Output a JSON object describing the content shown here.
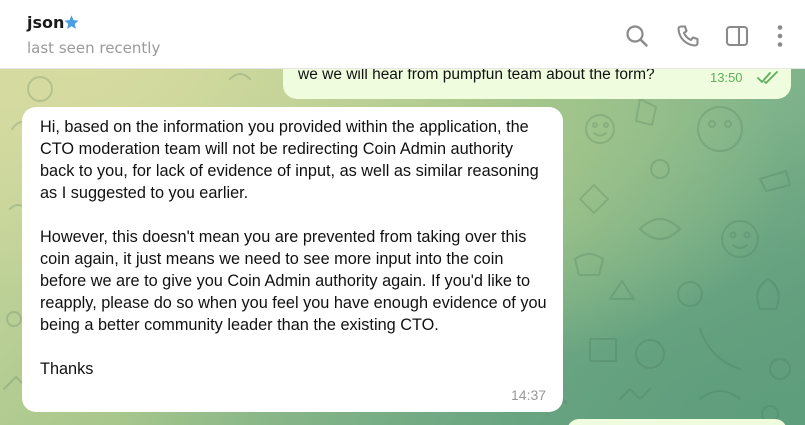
{
  "header": {
    "contact_name": "json",
    "status": "last seen recently",
    "icons": [
      "search-icon",
      "phone-icon",
      "sidebar-toggle-icon",
      "more-options-icon"
    ],
    "verified_star_color": "#4a9fe3"
  },
  "messages": [
    {
      "direction": "outgoing",
      "text": "we we will hear from pumpfun team about the form?",
      "time": "13:50",
      "read": true
    },
    {
      "direction": "incoming",
      "paragraphs": [
        "Hi, based on the information you provided within the application, the CTO moderation team will not be redirecting Coin Admin authority back to you, for lack of evidence of input, as well as similar reasoning as I suggested to you earlier.",
        "However, this doesn't mean you are prevented from taking over this coin again, it just means we need to see more input into the coin before we are to give you Coin Admin authority again. If you'd like to reapply, please do so when you feel you have enough evidence of you being a better community leader than the existing CTO.",
        "Thanks"
      ],
      "time": "14:37"
    }
  ],
  "colors": {
    "outgoing_bubble": "#effdde",
    "incoming_bubble": "#ffffff",
    "outgoing_time": "#5fae5a"
  }
}
